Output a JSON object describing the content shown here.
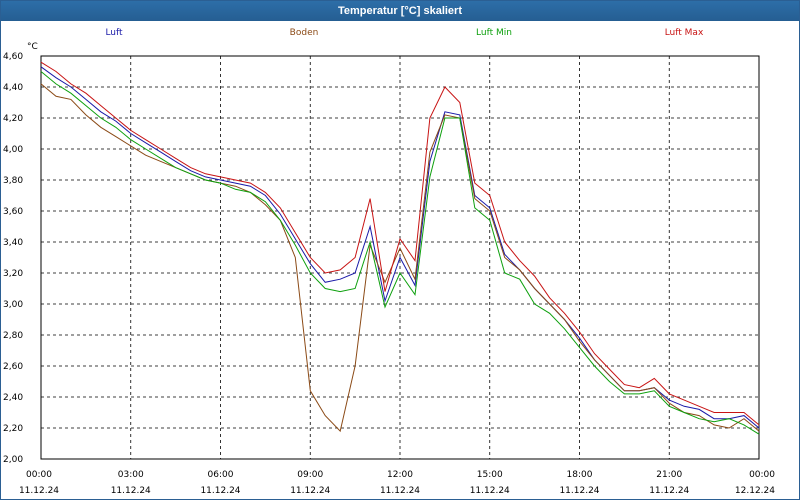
{
  "window": {
    "title": "Temperatur [°C] skaliert"
  },
  "chart_data": {
    "type": "line",
    "title": "Temperatur [°C] skaliert",
    "ylabel": "°C",
    "xlabel": "",
    "ylim": [
      2.0,
      4.6
    ],
    "y_ticks": [
      "2,00",
      "2,20",
      "2,40",
      "2,60",
      "2,80",
      "3,00",
      "3,20",
      "3,40",
      "3,60",
      "3,80",
      "4,00",
      "4,20",
      "4,40",
      "4,60"
    ],
    "x_ticks": [
      {
        "time": "00:00",
        "date": "11.12.24"
      },
      {
        "time": "03:00",
        "date": "11.12.24"
      },
      {
        "time": "06:00",
        "date": "11.12.24"
      },
      {
        "time": "09:00",
        "date": "11.12.24"
      },
      {
        "time": "12:00",
        "date": "11.12.24"
      },
      {
        "time": "15:00",
        "date": "11.12.24"
      },
      {
        "time": "18:00",
        "date": "11.12.24"
      },
      {
        "time": "21:00",
        "date": "11.12.24"
      },
      {
        "time": "00:00",
        "date": "12.12.24"
      }
    ],
    "grid": true,
    "legend_position": "top",
    "x_hours": [
      0,
      0.5,
      1,
      1.5,
      2,
      2.5,
      3,
      3.5,
      4,
      4.5,
      5,
      5.5,
      6,
      6.5,
      7,
      7.5,
      8,
      8.5,
      9,
      9.5,
      10,
      10.5,
      11,
      11.5,
      12,
      12.5,
      13,
      13.5,
      14,
      14.5,
      15,
      15.5,
      16,
      16.5,
      17,
      17.5,
      18,
      18.5,
      19,
      19.5,
      20,
      20.5,
      21,
      21.5,
      22,
      22.5,
      23,
      23.5,
      24
    ],
    "series": [
      {
        "name": "Luft",
        "color": "#1a1aa8",
        "values": [
          4.53,
          4.46,
          4.4,
          4.32,
          4.24,
          4.18,
          4.1,
          4.04,
          3.98,
          3.92,
          3.86,
          3.82,
          3.8,
          3.78,
          3.76,
          3.7,
          3.58,
          3.42,
          3.26,
          3.14,
          3.16,
          3.2,
          3.5,
          3.02,
          3.3,
          3.12,
          3.92,
          4.24,
          4.22,
          3.7,
          3.62,
          3.32,
          3.22,
          3.1,
          3.0,
          2.9,
          2.78,
          2.64,
          2.54,
          2.44,
          2.44,
          2.46,
          2.38,
          2.34,
          2.32,
          2.26,
          2.26,
          2.28,
          2.2
        ]
      },
      {
        "name": "Boden",
        "color": "#8b4a16",
        "values": [
          4.42,
          4.34,
          4.32,
          4.22,
          4.14,
          4.08,
          4.02,
          3.96,
          3.92,
          3.88,
          3.84,
          3.8,
          3.78,
          3.76,
          3.72,
          3.64,
          3.54,
          3.3,
          2.44,
          2.28,
          2.18,
          2.6,
          3.38,
          3.14,
          3.36,
          3.16,
          3.98,
          4.22,
          4.2,
          3.68,
          3.6,
          3.3,
          3.22,
          3.1,
          3.0,
          2.9,
          2.76,
          2.64,
          2.54,
          2.44,
          2.44,
          2.46,
          2.36,
          2.3,
          2.28,
          2.22,
          2.2,
          2.26,
          2.18
        ]
      },
      {
        "name": "Luft Min",
        "color": "#0ea00e",
        "values": [
          4.5,
          4.42,
          4.36,
          4.28,
          4.2,
          4.14,
          4.06,
          4.0,
          3.94,
          3.88,
          3.84,
          3.8,
          3.78,
          3.74,
          3.72,
          3.66,
          3.54,
          3.38,
          3.2,
          3.1,
          3.08,
          3.1,
          3.4,
          2.98,
          3.2,
          3.06,
          3.82,
          4.2,
          4.2,
          3.62,
          3.54,
          3.2,
          3.16,
          3.0,
          2.94,
          2.84,
          2.72,
          2.6,
          2.5,
          2.42,
          2.42,
          2.44,
          2.34,
          2.3,
          2.26,
          2.24,
          2.26,
          2.22,
          2.16
        ]
      },
      {
        "name": "Luft Max",
        "color": "#c81414",
        "values": [
          4.56,
          4.5,
          4.42,
          4.36,
          4.28,
          4.2,
          4.12,
          4.06,
          4.0,
          3.94,
          3.88,
          3.84,
          3.82,
          3.8,
          3.78,
          3.72,
          3.62,
          3.46,
          3.3,
          3.2,
          3.22,
          3.3,
          3.68,
          3.08,
          3.42,
          3.28,
          4.2,
          4.4,
          4.3,
          3.78,
          3.7,
          3.4,
          3.28,
          3.18,
          3.04,
          2.94,
          2.82,
          2.68,
          2.58,
          2.48,
          2.46,
          2.52,
          2.42,
          2.38,
          2.34,
          2.3,
          2.3,
          2.3,
          2.22
        ]
      }
    ]
  }
}
